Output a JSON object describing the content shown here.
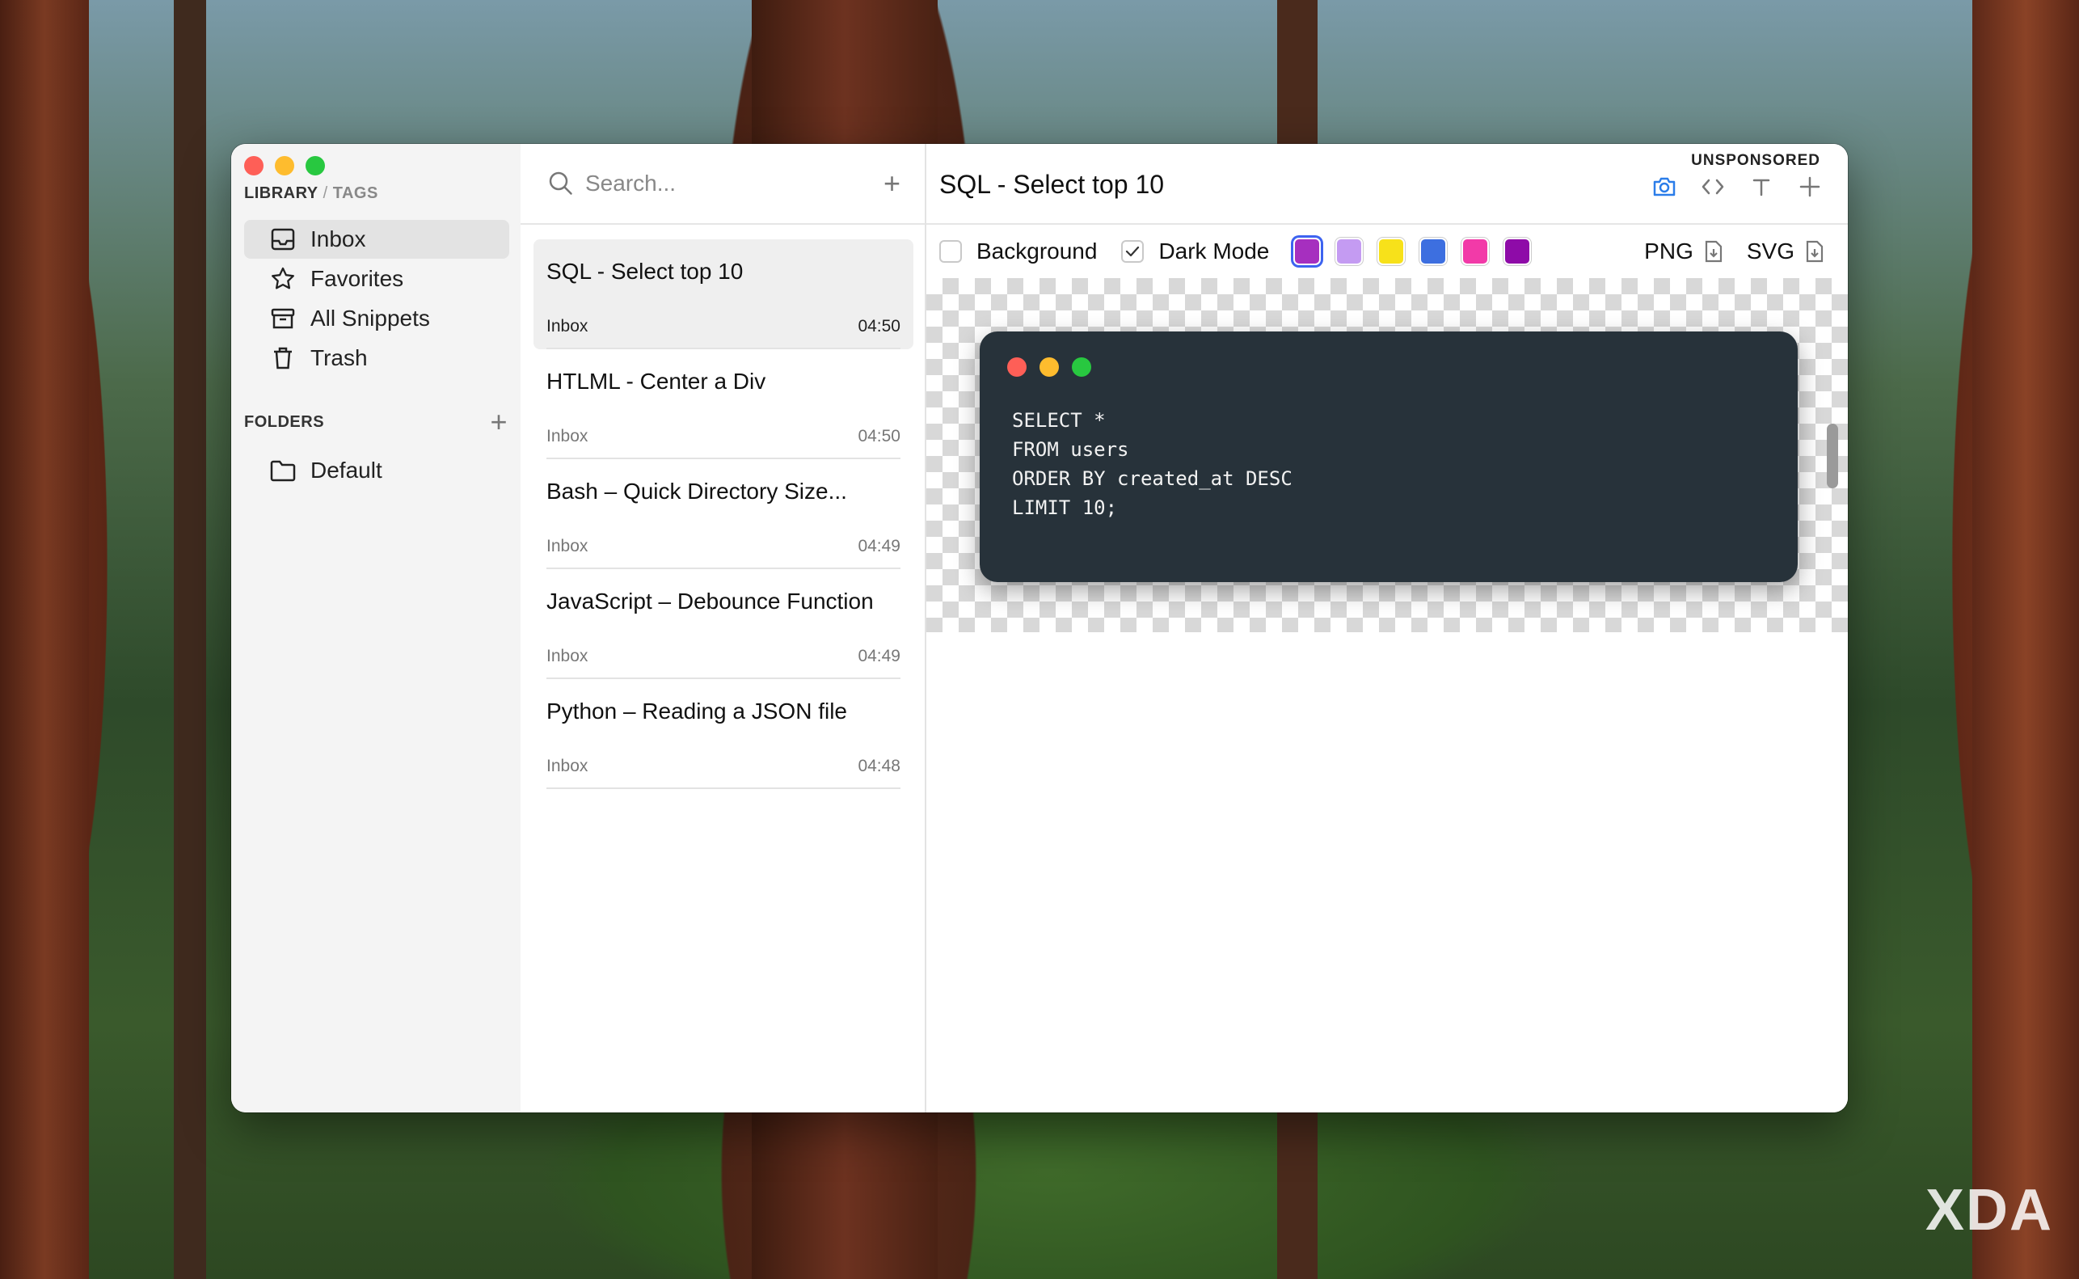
{
  "window": {
    "breadcrumb": {
      "library": "LIBRARY",
      "separator": "/",
      "tags": "TAGS"
    }
  },
  "sidebar": {
    "items": [
      {
        "label": "Inbox",
        "icon": "inbox-icon",
        "active": true
      },
      {
        "label": "Favorites",
        "icon": "star-icon",
        "active": false
      },
      {
        "label": "All Snippets",
        "icon": "archive-icon",
        "active": false
      },
      {
        "label": "Trash",
        "icon": "trash-icon",
        "active": false
      }
    ],
    "folders_heading": "FOLDERS",
    "folders": [
      {
        "label": "Default",
        "icon": "folder-icon"
      }
    ]
  },
  "snippets": {
    "search_placeholder": "Search...",
    "items": [
      {
        "title": "SQL - Select top 10",
        "folder": "Inbox",
        "time": "04:50",
        "active": true
      },
      {
        "title": "HTLML - Center a Div",
        "folder": "Inbox",
        "time": "04:50",
        "active": false
      },
      {
        "title": "Bash – Quick Directory Size...",
        "folder": "Inbox",
        "time": "04:49",
        "active": false
      },
      {
        "title": "JavaScript – Debounce Function",
        "folder": "Inbox",
        "time": "04:49",
        "active": false
      },
      {
        "title": "Python – Reading a JSON file",
        "folder": "Inbox",
        "time": "04:48",
        "active": false
      }
    ]
  },
  "editor": {
    "title": "SQL - Select top 10",
    "badge": "UNSPONSORED",
    "options": {
      "background_label": "Background",
      "background_checked": false,
      "dark_mode_label": "Dark Mode",
      "dark_mode_checked": true
    },
    "swatches": [
      "#a62fbf",
      "#c49bf2",
      "#f7e11a",
      "#3d6fe0",
      "#f23aa8",
      "#8e0ba8"
    ],
    "selected_swatch": 0,
    "export": {
      "png": "PNG",
      "svg": "SVG"
    },
    "code": "SELECT *\nFROM users\nORDER BY created_at DESC\nLIMIT 10;"
  },
  "watermark": "XDA"
}
